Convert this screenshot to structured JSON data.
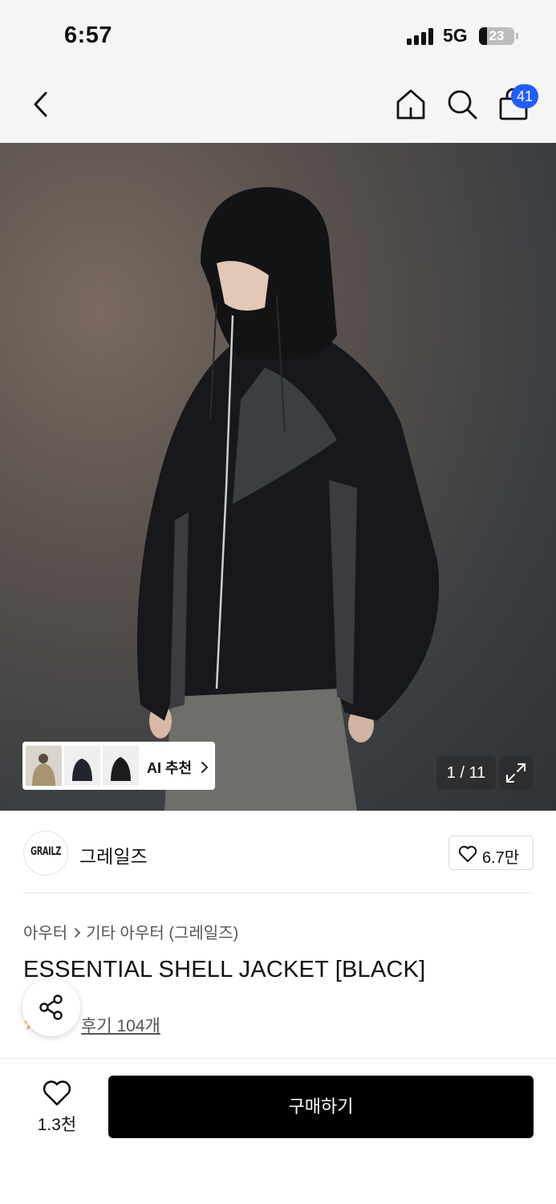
{
  "status_bar": {
    "time": "6:57",
    "network": "5G",
    "battery": "23",
    "battery_level": 0.23
  },
  "nav": {
    "back_icon": "chevron-left-icon",
    "home_icon": "home-icon",
    "search_icon": "search-icon",
    "cart_icon": "shopping-bag-icon",
    "cart_count": "41",
    "badge_color": "#1f5eff"
  },
  "gallery": {
    "ai_label": "AI 추천",
    "pager": "1 / 11",
    "expand_icon": "expand-icon"
  },
  "brand": {
    "logo_text": "GRAILZ",
    "name": "그레일즈",
    "likes": "6.7만"
  },
  "product": {
    "breadcrumb": [
      "아우터",
      "기타 아우터 (그레일즈)"
    ],
    "title": "ESSENTIAL SHELL JACKET [BLACK]",
    "reviews": "후기 104개",
    "star_color": "#f5a623"
  },
  "bottom": {
    "wish_count": "1.3천",
    "buy_label": "구매하기"
  }
}
